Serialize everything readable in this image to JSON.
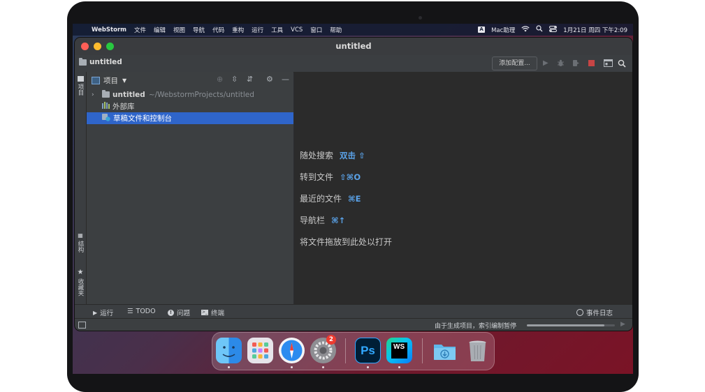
{
  "menubar": {
    "items": [
      "WebStorm",
      "文件",
      "编辑",
      "视图",
      "导航",
      "代码",
      "重构",
      "运行",
      "工具",
      "VCS",
      "窗口",
      "帮助"
    ],
    "input_source": "A",
    "assistant": "Mac助理",
    "datetime": "1月21日 周四 下午2:09"
  },
  "window": {
    "title": "untitled",
    "traffic_colors": {
      "close": "#ff5f57",
      "minimize": "#febc2e",
      "zoom": "#28c840"
    }
  },
  "navbar": {
    "project_name": "untitled",
    "add_config_label": "添加配置..."
  },
  "left_strip": {
    "project_tab": "项目",
    "structure_tab": "结构",
    "favorites_tab": "收藏夹"
  },
  "panel": {
    "title": "项目",
    "tree": [
      {
        "label": "untitled",
        "path": "~/WebstormProjects/untitled"
      },
      {
        "label": "外部库"
      },
      {
        "label": "草稿文件和控制台",
        "selected": true
      }
    ]
  },
  "editor_hints": [
    {
      "label": "随处搜索",
      "key": "双击 ⇧"
    },
    {
      "label": "转到文件",
      "key": "⇧⌘O"
    },
    {
      "label": "最近的文件",
      "key": "⌘E"
    },
    {
      "label": "导航栏",
      "key": "⌘↑"
    },
    {
      "label": "将文件拖放到此处以打开",
      "key": ""
    }
  ],
  "bottom_tools": {
    "run": "运行",
    "todo": "TODO",
    "problems": "问题",
    "terminal": "终端",
    "event_log": "事件日志"
  },
  "status": {
    "message": "由于生成项目，索引编制暂停",
    "progress": 0.88
  },
  "dock": {
    "apps": [
      "finder",
      "launchpad",
      "safari",
      "system-preferences",
      "photoshop",
      "webstorm",
      "downloads",
      "trash"
    ],
    "settings_badge": "2"
  }
}
